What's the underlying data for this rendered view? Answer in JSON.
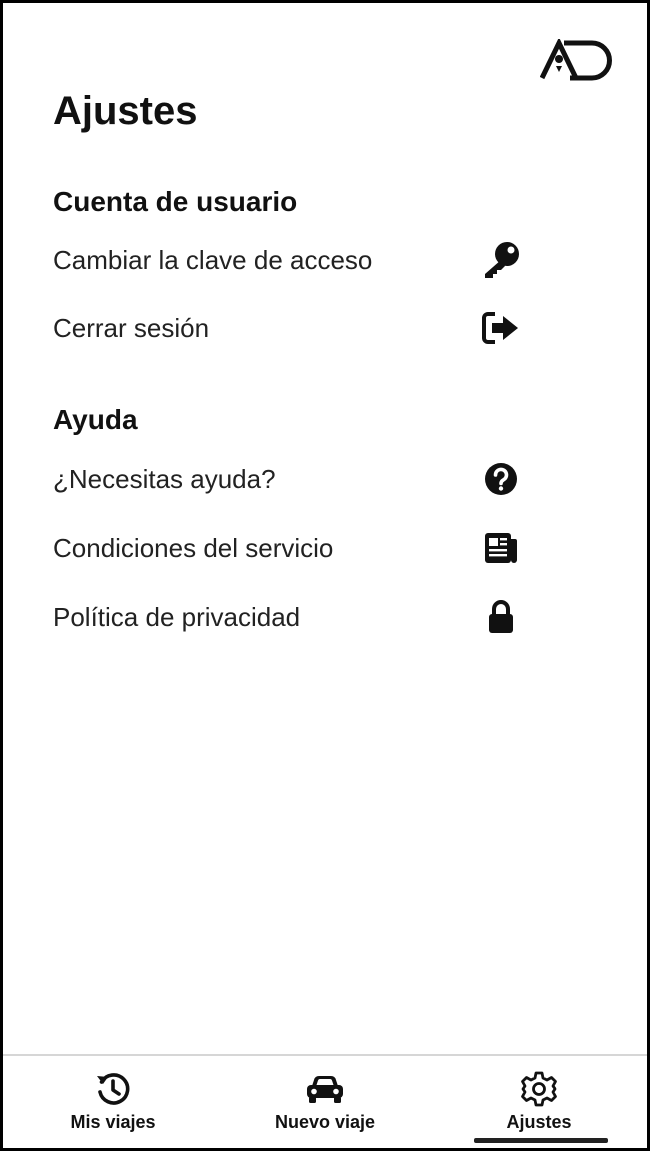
{
  "header": {
    "logo_text": "AD",
    "title": "Ajustes"
  },
  "sections": [
    {
      "title": "Cuenta de usuario",
      "items": [
        {
          "label": "Cambiar la clave de acceso",
          "icon": "key-icon"
        },
        {
          "label": "Cerrar sesión",
          "icon": "sign-out-icon"
        }
      ]
    },
    {
      "title": "Ayuda",
      "items": [
        {
          "label": "¿Necesitas ayuda?",
          "icon": "question-circle-icon"
        },
        {
          "label": "Condiciones del servicio",
          "icon": "newspaper-icon"
        },
        {
          "label": "Política de privacidad",
          "icon": "lock-icon"
        }
      ]
    }
  ],
  "bottom_nav": {
    "items": [
      {
        "label": "Mis viajes",
        "icon": "history-icon"
      },
      {
        "label": "Nuevo viaje",
        "icon": "car-icon"
      },
      {
        "label": "Ajustes",
        "icon": "gear-icon",
        "active": true
      }
    ]
  },
  "colors": {
    "text": "#111111",
    "border": "#000000",
    "nav_divider": "#d6d6d6",
    "active_indicator": "#222222"
  }
}
